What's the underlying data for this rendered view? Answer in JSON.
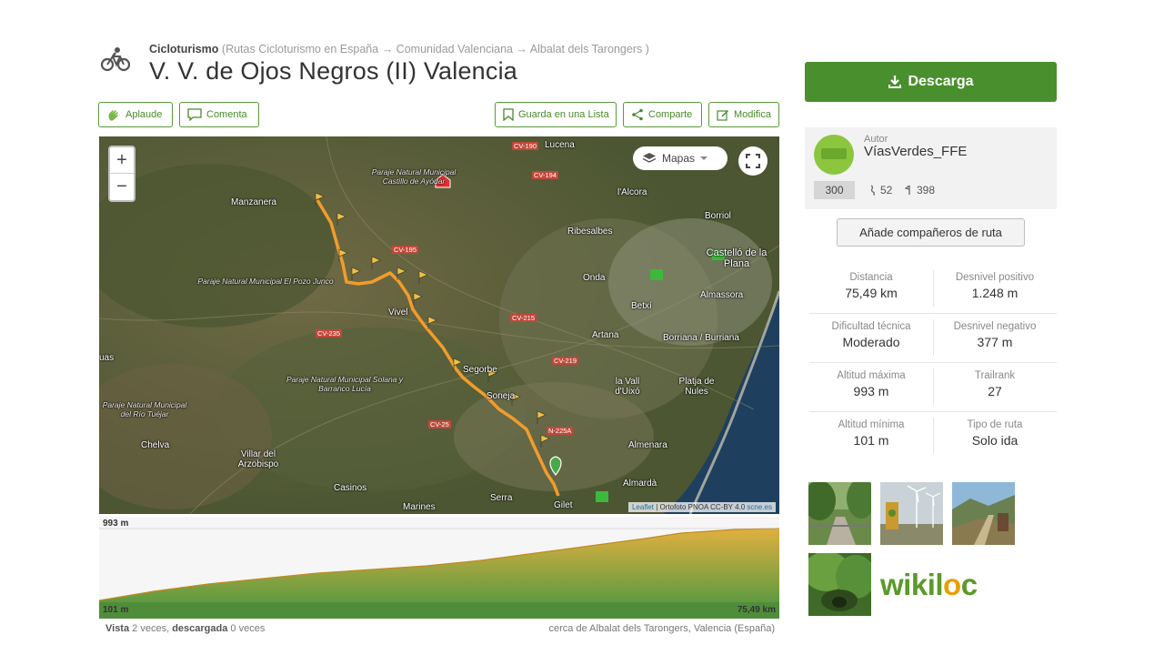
{
  "header": {
    "category": "Cicloturismo",
    "breadcrumb_open": "(",
    "breadcrumb": [
      "Rutas Cicloturismo en España",
      "Comunidad Valenciana",
      "Albalat dels Tarongers"
    ],
    "breadcrumb_sep": "→",
    "breadcrumb_close": ")",
    "title": "V. V. de Ojos Negros (II) Valencia"
  },
  "actions": {
    "applaud": "Aplaude",
    "comment": "Comenta",
    "save_list": "Guarda en una Lista",
    "share": "Comparte",
    "edit": "Modifica"
  },
  "map": {
    "layer_label": "Mapas",
    "zoom_in": "+",
    "zoom_out": "−",
    "attribution_leaflet": "Leaflet",
    "attribution_rest": " | Ortofoto PNOA CC-BY 4.0 ",
    "attribution_link": "scne.es",
    "places": [
      "Manzanera",
      "Paraje Natural Municipal Castillo de Ayódar",
      "Lucena",
      "l'Alcora",
      "Borriol",
      "Ribesalbes",
      "Castelló de la Plana",
      "Onda",
      "Betxí",
      "Almassora",
      "Vivel",
      "Paraje Natural Municipal El Pozo Junco",
      "Artana",
      "Borriana / Burriana",
      "Segorbe",
      "la Vall d'Uixó",
      "Platja de Nules",
      "Paraje Natural Municipal Solana y Barranco Lucía",
      "Paraje Natural Municipal del Río Tuéjar",
      "Chelva",
      "Almenara",
      "Villar del Arzobispo",
      "Almardà",
      "Casinos",
      "Marines",
      "Serra",
      "Gilet",
      "Soneja",
      "uas"
    ],
    "roads": [
      "CV-190",
      "CV-194",
      "CV-195",
      "CV-215",
      "CV-219",
      "CV-235",
      "CV-25",
      "N-225A"
    ]
  },
  "profile": {
    "max_elevation": "993 m",
    "min_elevation": "101 m",
    "distance": "75,49 km",
    "fill_color": "#e0b040",
    "base_color": "#5f9a40"
  },
  "footer": {
    "views_prefix": "Vista",
    "views_count": "2 veces,",
    "downloads_label": "descargada",
    "downloads_count": "0 veces",
    "location": "cerca de Albalat dels Tarongers, Valencia (España)"
  },
  "download": {
    "label": "Descarga",
    "color": "#4a8f2e"
  },
  "author": {
    "label": "Autor",
    "name": "VíasVerdes_FFE",
    "rank": "300",
    "routes": "52",
    "followers": "398"
  },
  "companions_button": "Añade compañeros de ruta",
  "stats": [
    {
      "label": "Distancia",
      "value": "75,49 km"
    },
    {
      "label": "Desnivel positivo",
      "value": "1.248 m"
    },
    {
      "label": "Dificultad técnica",
      "value": "Moderado"
    },
    {
      "label": "Desnivel negativo",
      "value": "377 m"
    },
    {
      "label": "Altitud máxima",
      "value": "993 m"
    },
    {
      "label": "Trailrank",
      "value": "27"
    },
    {
      "label": "Altitud mínima",
      "value": "101 m"
    },
    {
      "label": "Tipo de ruta",
      "value": "Solo ida"
    }
  ],
  "logo": {
    "text_a": "wikil",
    "text_o": "o",
    "text_b": "c"
  }
}
